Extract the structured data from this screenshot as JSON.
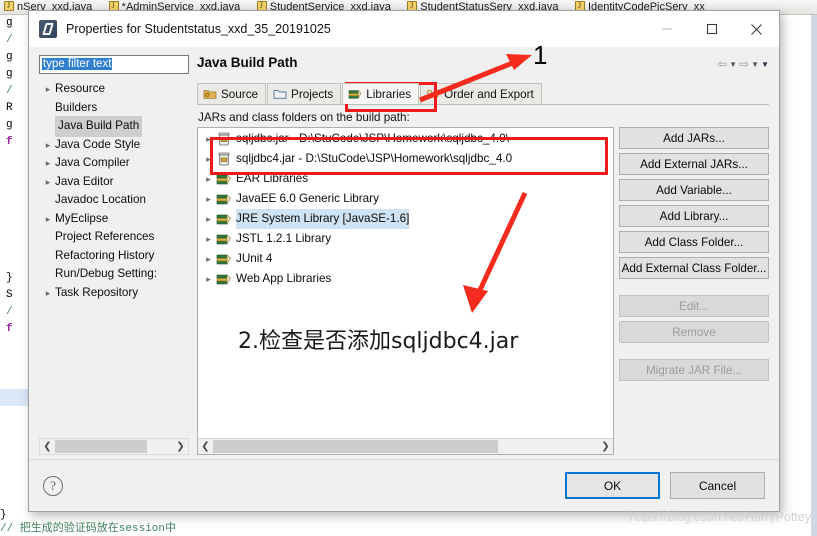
{
  "ide": {
    "tabs": [
      {
        "label": "nServ_xxd.java"
      },
      {
        "label": "*AdminService_xxd.java"
      },
      {
        "label": "StudentService_xxd.java"
      },
      {
        "label": "StudentStatusServ_xxd.java"
      },
      {
        "label": "IdentityCodePicServ_xx"
      }
    ],
    "code_lines": [
      {
        "text": "g",
        "style": "plain"
      },
      {
        "text": "/",
        "style": "comment"
      },
      {
        "text": "g",
        "style": "plain"
      },
      {
        "text": "g",
        "style": "plain"
      },
      {
        "text": "/",
        "style": "comment"
      },
      {
        "text": "R",
        "style": "plain"
      },
      {
        "text": "g",
        "style": "plain"
      },
      {
        "text": "f",
        "style": "keyword"
      }
    ],
    "code_lines_mid": [
      {
        "text": "}",
        "style": "plain"
      },
      {
        "text": "S",
        "style": "plain"
      },
      {
        "text": "/",
        "style": "comment"
      },
      {
        "text": "f",
        "style": "keyword"
      }
    ],
    "code_bottom_brace": "}",
    "code_bottom_comment": "// 把生成的验证码放在session中"
  },
  "dialog": {
    "title": "Properties for Studentstatus_xxd_35_20191025",
    "window_controls": {
      "minimize": "minimize-icon",
      "maximize": "maximize-icon",
      "close": "close-icon"
    },
    "filter": {
      "value": "type filter text",
      "placeholder": "type filter text"
    },
    "tree": [
      {
        "label": "Resource",
        "expandable": true,
        "selected": false
      },
      {
        "label": "Builders",
        "expandable": false,
        "selected": false
      },
      {
        "label": "Java Build Path",
        "expandable": false,
        "selected": true
      },
      {
        "label": "Java Code Style",
        "expandable": true,
        "selected": false
      },
      {
        "label": "Java Compiler",
        "expandable": true,
        "selected": false
      },
      {
        "label": "Java Editor",
        "expandable": true,
        "selected": false
      },
      {
        "label": "Javadoc Location",
        "expandable": false,
        "selected": false
      },
      {
        "label": "MyEclipse",
        "expandable": true,
        "selected": false
      },
      {
        "label": "Project References",
        "expandable": false,
        "selected": false
      },
      {
        "label": "Refactoring History",
        "expandable": false,
        "selected": false
      },
      {
        "label": "Run/Debug Setting:",
        "expandable": false,
        "selected": false
      },
      {
        "label": "Task Repository",
        "expandable": true,
        "selected": false
      }
    ],
    "page_title": "Java Build Path",
    "tabs": [
      {
        "label": "Source",
        "icon": "source-folder-icon",
        "active": false
      },
      {
        "label": "Projects",
        "icon": "projects-folder-icon",
        "active": false
      },
      {
        "label": "Libraries",
        "icon": "libraries-book-icon",
        "active": true
      },
      {
        "label": "Order and Export",
        "icon": "order-export-icon",
        "active": false
      }
    ],
    "build_path_label": "JARs and class folders on the build path:",
    "entries": [
      {
        "label": "sqljdbc.jar - D:\\StuCode\\JSP\\Homework\\sqljdbc_4.0\\",
        "icon": "jar-icon",
        "highlighted": false
      },
      {
        "label": "sqljdbc4.jar - D:\\StuCode\\JSP\\Homework\\sqljdbc_4.0",
        "icon": "jar-icon",
        "highlighted": false
      },
      {
        "label": "EAR Libraries",
        "icon": "library-icon",
        "highlighted": false
      },
      {
        "label": "JavaEE 6.0 Generic Library",
        "icon": "library-icon",
        "highlighted": false
      },
      {
        "label": "JRE System Library [JavaSE-1.6]",
        "icon": "library-icon",
        "highlighted": true
      },
      {
        "label": "JSTL 1.2.1 Library",
        "icon": "library-icon",
        "highlighted": false
      },
      {
        "label": "JUnit 4",
        "icon": "library-icon",
        "highlighted": false
      },
      {
        "label": "Web App Libraries",
        "icon": "library-icon",
        "highlighted": false
      }
    ],
    "buttons": [
      {
        "label": "Add JARs...",
        "disabled": false
      },
      {
        "label": "Add External JARs...",
        "disabled": false
      },
      {
        "label": "Add Variable...",
        "disabled": false
      },
      {
        "label": "Add Library...",
        "disabled": false
      },
      {
        "label": "Add Class Folder...",
        "disabled": false
      },
      {
        "label": "Add External Class Folder...",
        "disabled": false
      },
      {
        "label": "Edit...",
        "disabled": true
      },
      {
        "label": "Remove",
        "disabled": true
      },
      {
        "label": "Migrate JAR File...",
        "disabled": true
      }
    ],
    "footer": {
      "help": "?",
      "ok": "OK",
      "cancel": "Cancel"
    }
  },
  "annotations": {
    "step1_number": "1",
    "step2_text": "2.检查是否添加sqljdbc4.jar",
    "highlight_color": "#f01a1a",
    "arrow_color": "#f52b1e"
  },
  "watermark": "https://blog.csdn.net/HarryPottey"
}
